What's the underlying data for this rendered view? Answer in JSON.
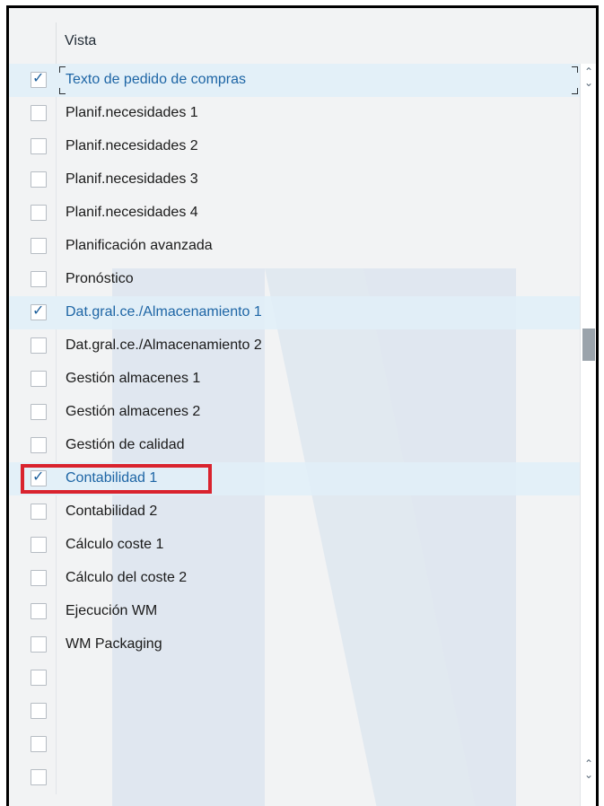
{
  "table": {
    "column_header": "Vista",
    "rows": [
      {
        "label": "Texto de pedido de compras",
        "checked": true
      },
      {
        "label": "Planif.necesidades 1",
        "checked": false
      },
      {
        "label": "Planif.necesidades 2",
        "checked": false
      },
      {
        "label": "Planif.necesidades 3",
        "checked": false
      },
      {
        "label": "Planif.necesidades 4",
        "checked": false
      },
      {
        "label": "Planificación avanzada",
        "checked": false
      },
      {
        "label": "Pronóstico",
        "checked": false
      },
      {
        "label": "Dat.gral.ce./Almacenamiento 1",
        "checked": true
      },
      {
        "label": "Dat.gral.ce./Almacenamiento 2",
        "checked": false
      },
      {
        "label": "Gestión almacenes 1",
        "checked": false
      },
      {
        "label": "Gestión almacenes 2",
        "checked": false
      },
      {
        "label": "Gestión de calidad",
        "checked": false
      },
      {
        "label": "Contabilidad 1",
        "checked": true
      },
      {
        "label": "Contabilidad 2",
        "checked": false
      },
      {
        "label": "Cálculo coste 1",
        "checked": false
      },
      {
        "label": "Cálculo del coste 2",
        "checked": false
      },
      {
        "label": "Ejecución WM",
        "checked": false
      },
      {
        "label": "WM Packaging",
        "checked": false
      },
      {
        "label": "",
        "checked": false
      },
      {
        "label": "",
        "checked": false
      },
      {
        "label": "",
        "checked": false
      },
      {
        "label": "",
        "checked": false
      }
    ]
  },
  "icons": {
    "checkmark": "✓",
    "scroll_up": "⌃",
    "scroll_down": "⌄"
  },
  "colors": {
    "selected_text": "#1d65a5",
    "selected_row_bg": "#e1eef8",
    "highlight_border": "#d9232e",
    "checkmark": "#1c5f9c"
  }
}
